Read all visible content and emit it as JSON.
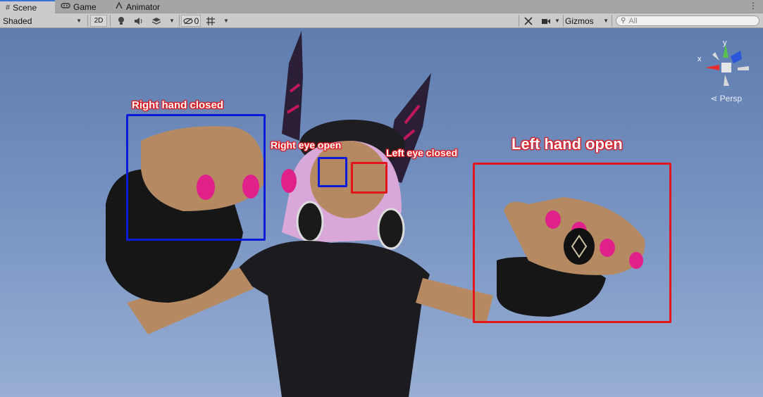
{
  "tabs": [
    {
      "label": "Scene",
      "icon": "grid-icon"
    },
    {
      "label": "Game",
      "icon": "gamepad-icon"
    },
    {
      "label": "Animator",
      "icon": "animator-icon"
    }
  ],
  "toolbar": {
    "shading_mode": "Shaded",
    "mode_2d": "2D",
    "hidden_count": "0",
    "gizmos_label": "Gizmos",
    "search_placeholder": "All"
  },
  "gizmo": {
    "projection_label": "Persp",
    "axis_x": "x",
    "axis_y": "y"
  },
  "annotations": {
    "right_hand_closed": "Right hand closed",
    "right_eye_open": "Right eye open",
    "left_eye_closed": "Left eye closed",
    "left_hand_open": "Left hand open"
  },
  "colors": {
    "box_blue": "#0b1bd8",
    "box_red": "#e0161b",
    "sky_top": "#5e7cae",
    "sky_bottom": "#98aed3"
  }
}
